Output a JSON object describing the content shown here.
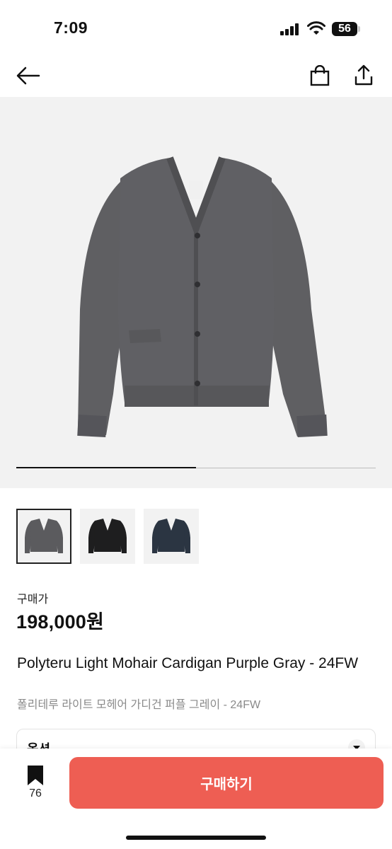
{
  "status_bar": {
    "time": "7:09",
    "battery": "56"
  },
  "nav": {
    "back_icon": "arrow-left-icon",
    "bag_icon": "shopping-bag-icon",
    "share_icon": "share-icon"
  },
  "gallery": {
    "image_alt": "gray cardigan",
    "progress": 0.5
  },
  "thumbnails": [
    {
      "color": "#5b5b5e",
      "selected": true
    },
    {
      "color": "#1e1e1f",
      "selected": false
    },
    {
      "color": "#2b3542",
      "selected": false
    }
  ],
  "product": {
    "price_label": "구매가",
    "price": "198,000원",
    "title": "Polyteru Light Mohair Cardigan Purple Gray - 24FW",
    "subtitle": "폴리테루 라이트 모헤어 가디건 퍼플 그레이 - 24FW"
  },
  "option": {
    "label": "옵션"
  },
  "bottom_bar": {
    "bookmark_count": "76",
    "buy_label": "구매하기"
  },
  "colors": {
    "accent": "#ee5e53",
    "gallery_bg": "#f2f2f2"
  }
}
